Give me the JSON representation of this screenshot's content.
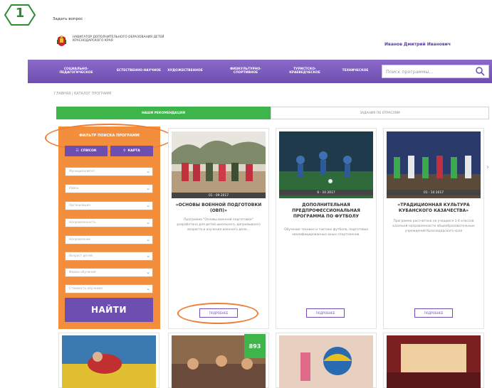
{
  "step": "1",
  "colors": {
    "green": "#3db54a",
    "purple": "#6e4fb0",
    "orange": "#f28e3c"
  },
  "header": {
    "ask_link": "Задать вопрос",
    "org_title": "НАВИГАТОР ДОПОЛНИТЕЛЬНОГО ОБРАЗОВАНИЯ ДЕТЕЙ КРАСНОДАРСКОГО КРАЯ",
    "user_name": "Иванов Дмитрий Иванович"
  },
  "nav": {
    "items": [
      "СОЦИАЛЬНО-ПЕДАГОГИЧЕСКОЕ",
      "ЕСТЕСТВЕННО-НАУЧНОЕ",
      "ХУДОЖЕСТВЕННОЕ",
      "ФИЗКУЛЬТУРНО-СПОРТИВНОЕ",
      "ТУРИСТСКО-КРАЕВЕДЧЕСКОЕ",
      "ТЕХНИЧЕСКОЕ"
    ],
    "search_placeholder": "Поиск программы..."
  },
  "breadcrumb": "ГЛАВНАЯ | КАТАЛОГ ПРОГРАММ",
  "tabs": {
    "active": "НАШИ РЕКОМЕНДАЦИИ",
    "inactive": "ЗАДАНИЯ ПО ОТРАСЛЯМ"
  },
  "filter": {
    "heading": "ФИЛЬТР ПОИСКА ПРОГРАММ",
    "list_button": "СПИСОК",
    "map_button": "КАРТА",
    "selects": [
      "Муниципалитет",
      "Район",
      "Организация",
      "Направленность",
      "Направление",
      "Возраст детей",
      "Форма обучения",
      "Стоимость обучения"
    ],
    "find_button": "НАЙТИ"
  },
  "cards": [
    {
      "date": "01 - 09 2017",
      "title": "«ОСНОВЫ ВОЕННОЙ ПОДГОТОВКИ (ОВП)»",
      "description": "Программа \"Основы военной подготовки\" разработана для детей школьного, допризывного возраста и изучения военного дела...",
      "more": "ПОДРОБНЕЕ"
    },
    {
      "date": "6 - 10 2017",
      "title": "ДОПОЛНИТЕЛЬНАЯ ПРЕДПРОФЕССИОНАЛЬНАЯ ПРОГРАММА ПО ФУТБОЛУ",
      "description": "Обучение технике и тактике футбола, подготовка квалифицированных юных спортсменов.",
      "more": "ПОДРОБНЕЕ"
    },
    {
      "date": "01 - 10 2017",
      "title": "«ТРАДИЦИОННАЯ КУЛЬТУРА КУБАНСКОГО КАЗАЧЕСТВА»",
      "description": "Программа рассчитана на учащихся 1-4 классов казачьей направленности общеобразовательных учреждений Краснодарского края",
      "more": "ПОДРОБНЕЕ"
    }
  ],
  "bottom_badge": "893"
}
